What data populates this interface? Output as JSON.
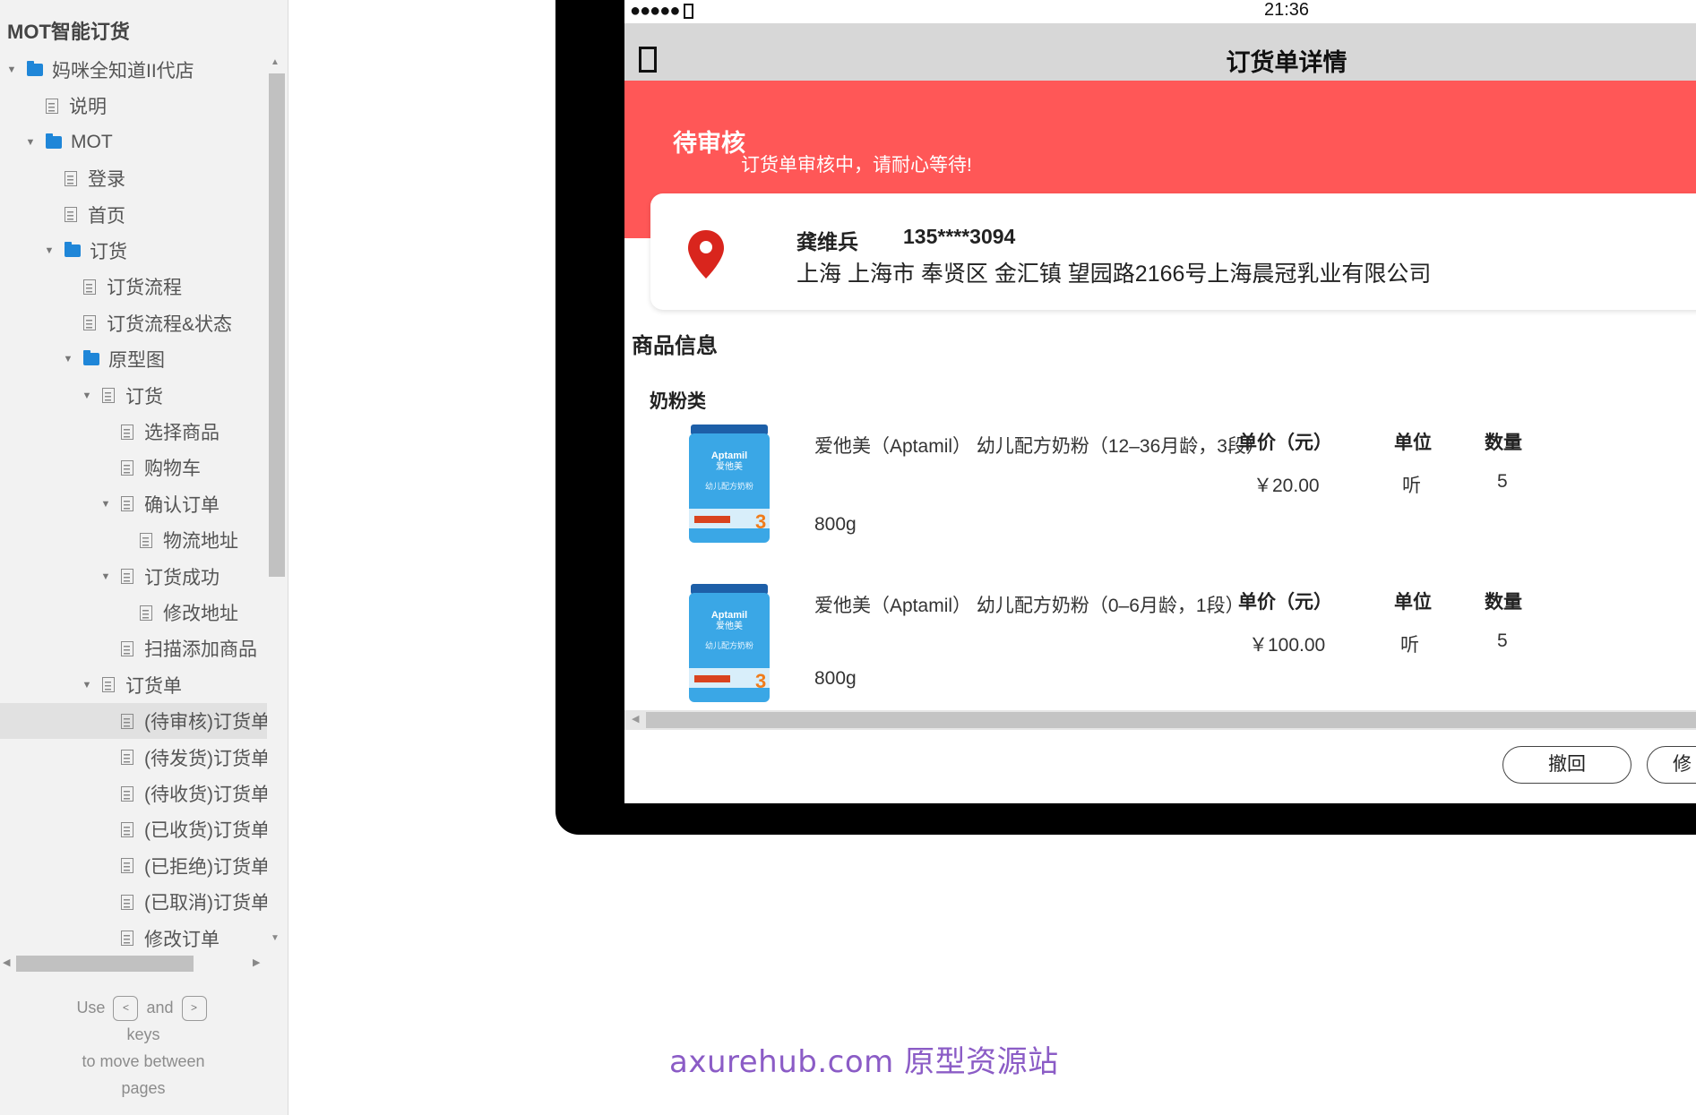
{
  "app": {
    "title": "MOT智能订货"
  },
  "sidebar": {
    "tree": [
      {
        "label": "妈咪全知道II代店",
        "type": "folder",
        "expanded": true,
        "level": 0
      },
      {
        "label": "说明",
        "type": "page",
        "level": 1
      },
      {
        "label": "MOT",
        "type": "folder",
        "expanded": true,
        "level": 1
      },
      {
        "label": "登录",
        "type": "page",
        "level": 2
      },
      {
        "label": "首页",
        "type": "page",
        "level": 2
      },
      {
        "label": "订货",
        "type": "folder",
        "expanded": true,
        "level": 2
      },
      {
        "label": "订货流程",
        "type": "page",
        "level": 3
      },
      {
        "label": "订货流程&状态",
        "type": "page",
        "level": 3
      },
      {
        "label": "原型图",
        "type": "folder",
        "expanded": true,
        "level": 3
      },
      {
        "label": "订货",
        "type": "page",
        "expanded": true,
        "level": 4
      },
      {
        "label": "选择商品",
        "type": "page",
        "level": 5
      },
      {
        "label": "购物车",
        "type": "page",
        "level": 5
      },
      {
        "label": "确认订单",
        "type": "page",
        "expanded": true,
        "level": 5
      },
      {
        "label": "物流地址",
        "type": "page",
        "level": 6
      },
      {
        "label": "订货成功",
        "type": "page",
        "expanded": true,
        "level": 5
      },
      {
        "label": "修改地址",
        "type": "page",
        "level": 6
      },
      {
        "label": "扫描添加商品",
        "type": "page",
        "level": 5
      },
      {
        "label": "订货单",
        "type": "page",
        "expanded": true,
        "level": 4
      },
      {
        "label": "(待审核)订货单",
        "type": "page",
        "level": 5,
        "selected": true
      },
      {
        "label": "(待发货)订货单",
        "type": "page",
        "level": 5
      },
      {
        "label": "(待收货)订货单",
        "type": "page",
        "level": 5
      },
      {
        "label": "(已收货)订货单",
        "type": "page",
        "level": 5
      },
      {
        "label": "(已拒绝)订货单",
        "type": "page",
        "level": 5
      },
      {
        "label": "(已取消)订货单",
        "type": "page",
        "level": 5
      },
      {
        "label": "修改订单",
        "type": "page",
        "level": 5
      }
    ],
    "hint": {
      "use": "Use",
      "key_prev": "<",
      "and": "and",
      "key_next": ">",
      "keys": "keys",
      "to_move": "to move between",
      "pages": "pages"
    }
  },
  "device": {
    "status_bar": {
      "signal": "●●●●●",
      "time": "21:36"
    },
    "nav": {
      "title": "订货单详情"
    },
    "banner": {
      "title": "待审核",
      "subtitle": "订货单审核中，请耐心等待!",
      "color": "#ff5757"
    },
    "address": {
      "name": "龚维兵",
      "phone": "135****3094",
      "address": "上海 上海市 奉贤区  金汇镇  望园路2166号上海晨冠乳业有限公司"
    },
    "goods": {
      "section_title": "商品信息",
      "category": "奶粉类",
      "columns": {
        "price": "单价（元）",
        "unit": "单位",
        "qty": "数量"
      },
      "items": [
        {
          "name": "爱他美（Aptamil） 幼儿配方奶粉（12–36月龄，3段）",
          "spec": "800g",
          "price": "￥20.00",
          "unit": "听",
          "qty": "5"
        },
        {
          "name": "爱他美（Aptamil） 幼儿配方奶粉（0–6月龄，1段）",
          "spec": "800g",
          "price": "￥100.00",
          "unit": "听",
          "qty": "5"
        }
      ]
    },
    "actions": {
      "withdraw": "撤回",
      "modify": "修"
    }
  },
  "watermark": "axurehub.com 原型资源站",
  "colors": {
    "accent_folder": "#1f86d8",
    "watermark": "#8b5cc6",
    "banner": "#ff5757"
  }
}
